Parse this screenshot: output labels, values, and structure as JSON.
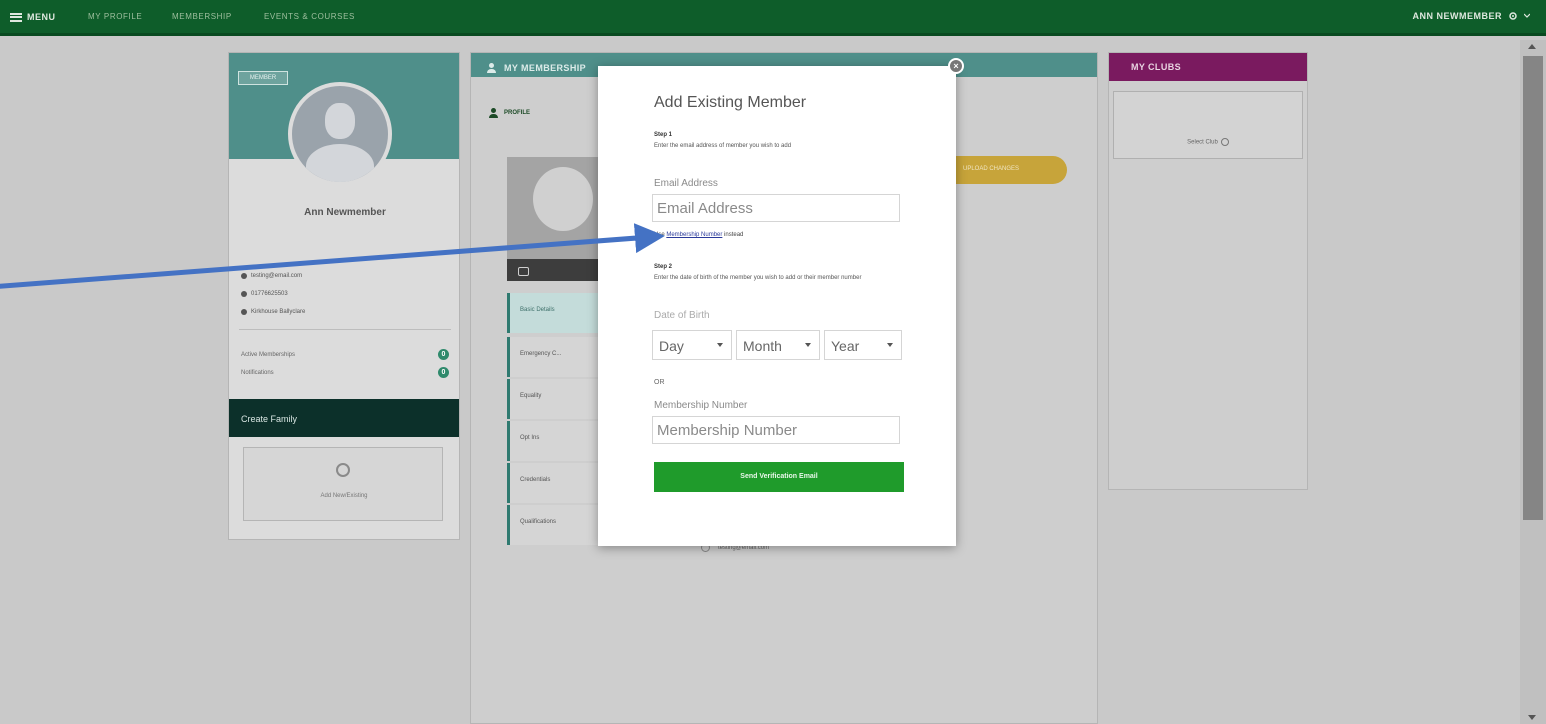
{
  "topbar": {
    "menu_label": "MENU",
    "nav_items": [
      "MY PROFILE",
      "MEMBERSHIP",
      "EVENTS & COURSES"
    ],
    "user_name": "ANN NEWMEMBER"
  },
  "profile": {
    "badge": "MEMBER",
    "name": "Ann Newmember",
    "email": "testing@email.com",
    "phone": "01776625503",
    "location": "Kirkhouse Ballyclare",
    "active_memberships_label": "Active Memberships",
    "active_memberships_count": "0",
    "notifications_label": "Notifications",
    "notifications_count": "0",
    "create_family_label": "Create Family",
    "add_new_label": "Add New/Existing"
  },
  "membership": {
    "title": "MY MEMBERSHIP",
    "profile_tab": "PROFILE",
    "side_tabs": [
      "Basic Details",
      "Emergency C...",
      "Equality",
      "Opt Ins",
      "Credentials",
      "Qualifications"
    ],
    "pill_label": "UPLOAD CHANGES",
    "email_under": "testing@email.com"
  },
  "clubs": {
    "title": "MY CLUBS",
    "select_label": "Select Club"
  },
  "modal": {
    "title": "Add Existing Member",
    "step1_label": "Step 1",
    "step1_desc": "Enter the email address of member you wish to add",
    "email_label": "Email Address",
    "email_placeholder": "Email Address",
    "link_prefix": "Use",
    "link_text": "Membership Number",
    "link_suffix": "instead",
    "step2_label": "Step 2",
    "step2_desc": "Enter the date of birth of the member you wish to add or their member number",
    "dob_label": "Date of Birth",
    "day": "Day",
    "month": "Month",
    "year": "Year",
    "or_label": "OR",
    "member_number_label": "Membership Number",
    "member_number_placeholder": "Membership Number",
    "button_label": "Send Verification Email",
    "close_symbol": "×"
  },
  "colors": {
    "nav_green": "#0e5d2a",
    "teal": "#4f8f8a",
    "clubs_purple": "#7a1a5f",
    "button_green": "#1f9b2b",
    "annotation_blue": "#4472c4"
  }
}
